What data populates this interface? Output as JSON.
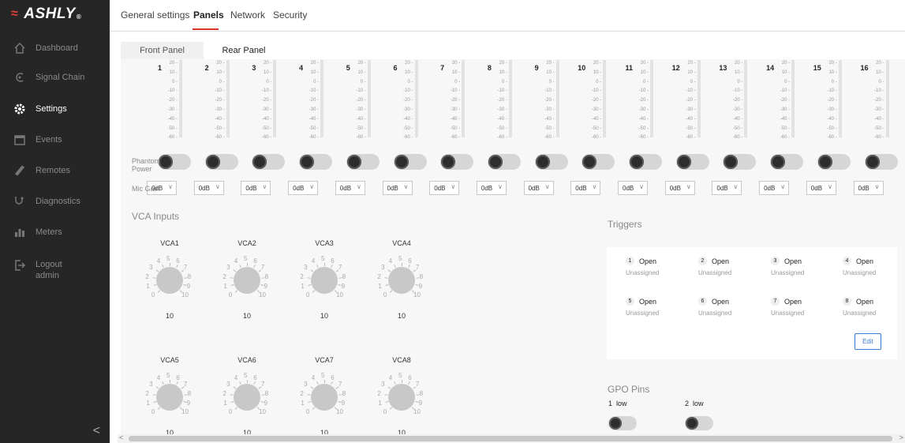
{
  "brand": {
    "name": "ASHLY",
    "reg": "®"
  },
  "sidebar": {
    "items": [
      {
        "label": "Dashboard",
        "icon": "home-icon"
      },
      {
        "label": "Signal Chain",
        "icon": "signal-chain-icon"
      },
      {
        "label": "Settings",
        "icon": "gear-icon",
        "active": true
      },
      {
        "label": "Events",
        "icon": "calendar-icon"
      },
      {
        "label": "Remotes",
        "icon": "remote-icon"
      },
      {
        "label": "Diagnostics",
        "icon": "stethoscope-icon"
      },
      {
        "label": "Meters",
        "icon": "meters-icon"
      }
    ],
    "logout": {
      "label": "Logout",
      "user": "admin"
    },
    "collapse_glyph": "<"
  },
  "top_tabs": [
    "General settings",
    "Panels",
    "Network",
    "Security"
  ],
  "sub_tabs": {
    "front": "Front Panel",
    "rear": "Rear Panel"
  },
  "channels": [
    "1",
    "2",
    "3",
    "4",
    "5",
    "6",
    "7",
    "8",
    "9",
    "10",
    "11",
    "12",
    "13",
    "14",
    "15",
    "16"
  ],
  "meter_scale": [
    "20 -",
    "10 -",
    "0 -",
    "-10 -",
    "-20 -",
    "-30 -",
    "-40 -",
    "-50 -",
    "-60 -"
  ],
  "labels": {
    "phantom": "Phantom Power",
    "phantom_l1": "Phantom",
    "phantom_l2": "Power",
    "mic_gain": "Mic Gain"
  },
  "mic_gain_value": "0dB",
  "vca": {
    "title": "VCA Inputs",
    "dial_numbers": [
      "0",
      "1",
      "2",
      "3",
      "4",
      "5",
      "6",
      "7",
      "8",
      "9",
      "10"
    ],
    "items": [
      {
        "name": "VCA1",
        "value": "10"
      },
      {
        "name": "VCA2",
        "value": "10"
      },
      {
        "name": "VCA3",
        "value": "10"
      },
      {
        "name": "VCA4",
        "value": "10"
      },
      {
        "name": "VCA5",
        "value": "10"
      },
      {
        "name": "VCA6",
        "value": "10"
      },
      {
        "name": "VCA7",
        "value": "10"
      },
      {
        "name": "VCA8",
        "value": "10"
      }
    ]
  },
  "triggers": {
    "title": "Triggers",
    "items": [
      {
        "n": "1",
        "state": "Open",
        "assign": "Unassigned"
      },
      {
        "n": "2",
        "state": "Open",
        "assign": "Unassigned"
      },
      {
        "n": "3",
        "state": "Open",
        "assign": "Unassigned"
      },
      {
        "n": "4",
        "state": "Open",
        "assign": "Unassigned"
      },
      {
        "n": "5",
        "state": "Open",
        "assign": "Unassigned"
      },
      {
        "n": "6",
        "state": "Open",
        "assign": "Unassigned"
      },
      {
        "n": "7",
        "state": "Open",
        "assign": "Unassigned"
      },
      {
        "n": "8",
        "state": "Open",
        "assign": "Unassigned"
      }
    ],
    "edit_label": "Edit"
  },
  "gpo": {
    "title": "GPO Pins",
    "items": [
      {
        "n": "1",
        "state": "low"
      },
      {
        "n": "2",
        "state": "low"
      }
    ]
  },
  "scrollbar": {
    "left": "<",
    "right": ">"
  },
  "colors": {
    "accent": "#d9312c",
    "sidebar": "#262626",
    "link": "#3a7bd5"
  }
}
